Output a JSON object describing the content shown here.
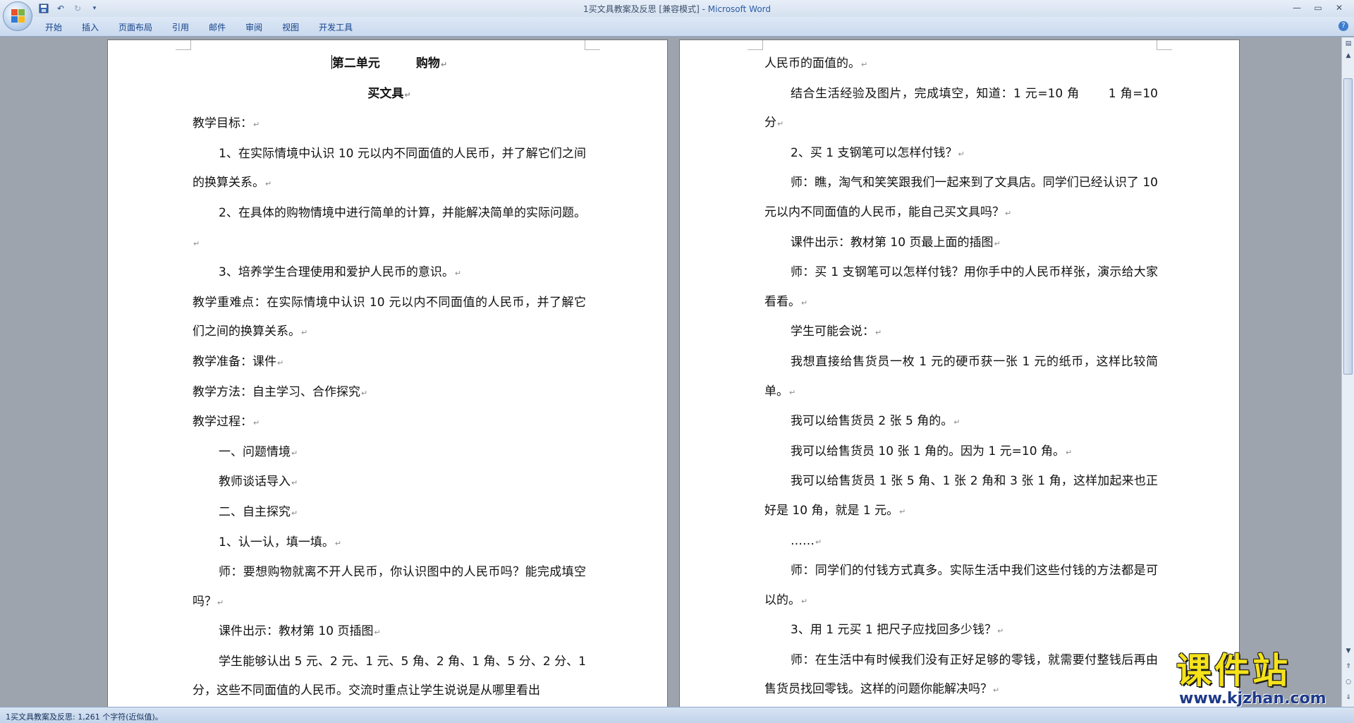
{
  "window": {
    "title_doc": "1买文具教案及反思 [兼容模式] - ",
    "title_app": "Microsoft Word"
  },
  "ribbon": {
    "tabs": [
      "开始",
      "插入",
      "页面布局",
      "引用",
      "邮件",
      "审阅",
      "视图",
      "开发工具"
    ]
  },
  "colors": {
    "titlebar": "#d5e1f0",
    "ribbon_text": "#15428b",
    "workspace": "#9ea4ad",
    "watermark_yellow": "#f5e21a",
    "watermark_blue": "#1d3a8a"
  },
  "icons": {
    "office_button": "office-logo-icon",
    "save": "save-icon",
    "undo": "undo-icon",
    "redo": "redo-icon",
    "customize": "dropdown-arrow-icon",
    "help": "help-icon"
  },
  "document": {
    "left_page": [
      {
        "text": "第二单元　　　购物",
        "style": "center bold",
        "cursor": true
      },
      {
        "text": "买文具",
        "style": "center bold"
      },
      {
        "text": "教学目标：",
        "style": ""
      },
      {
        "text": "1、在实际情境中认识 10 元以内不同面值的人民币，并了解它们之间的换算关系。",
        "style": "indent"
      },
      {
        "text": "2、在具体的购物情境中进行简单的计算，并能解决简单的实际问题。",
        "style": "indent"
      },
      {
        "text": "3、培养学生合理使用和爱护人民币的意识。",
        "style": "indent"
      },
      {
        "text": "教学重难点：在实际情境中认识 10 元以内不同面值的人民币，并了解它们之间的换算关系。",
        "style": ""
      },
      {
        "text": "教学准备：课件",
        "style": ""
      },
      {
        "text": "教学方法：自主学习、合作探究",
        "style": ""
      },
      {
        "text": "教学过程：",
        "style": ""
      },
      {
        "text": "一、问题情境",
        "style": "indent"
      },
      {
        "text": "教师谈话导入",
        "style": "indent"
      },
      {
        "text": "二、自主探究",
        "style": "indent"
      },
      {
        "text": "1、认一认，填一填。",
        "style": "indent"
      },
      {
        "text": "师：要想购物就离不开人民币，你认识图中的人民币吗？能完成填空吗？",
        "style": "indent"
      },
      {
        "text": "课件出示：教材第 10 页插图",
        "style": "indent"
      },
      {
        "text": "学生能够认出 5 元、2 元、1 元、5 角、2 角、1 角、5 分、2 分、1 分，这些不同面值的人民币。交流时重点让学生说说是从哪里看出",
        "style": "indent",
        "no_mark": true
      }
    ],
    "right_page": [
      {
        "text": "人民币的面值的。",
        "style": ""
      },
      {
        "text": "结合生活经验及图片，完成填空，知道：1 元=10 角　　 1 角=10 分",
        "style": "indent"
      },
      {
        "text": "2、买 1 支钢笔可以怎样付钱？",
        "style": "indent"
      },
      {
        "text": "师：瞧，淘气和笑笑跟我们一起来到了文具店。同学们已经认识了 10 元以内不同面值的人民币，能自己买文具吗？",
        "style": "indent"
      },
      {
        "text": "课件出示：教材第 10 页最上面的插图",
        "style": "indent"
      },
      {
        "text": "师：买 1 支钢笔可以怎样付钱？用你手中的人民币样张，演示给大家看看。",
        "style": "indent"
      },
      {
        "text": "学生可能会说：",
        "style": "indent"
      },
      {
        "text": "我想直接给售货员一枚 1 元的硬币获一张 1 元的纸币，这样比较简单。",
        "style": "indent"
      },
      {
        "text": "我可以给售货员 2 张 5 角的。",
        "style": "indent"
      },
      {
        "text": "我可以给售货员 10 张 1 角的。因为 1 元=10 角。",
        "style": "indent"
      },
      {
        "text": "我可以给售货员 1 张 5 角、1 张 2 角和 3 张 1 角，这样加起来也正好是 10 角，就是 1 元。",
        "style": "indent"
      },
      {
        "text": "……",
        "style": "indent"
      },
      {
        "text": "师：同学们的付钱方式真多。实际生活中我们这些付钱的方法都是可以的。",
        "style": "indent"
      },
      {
        "text": "3、用 1 元买 1 把尺子应找回多少钱？",
        "style": "indent"
      },
      {
        "text": "师：在生活中有时候我们没有正好足够的零钱，就需要付整钱后再由售货员找回零钱。这样的问题你能解决吗？",
        "style": "indent"
      }
    ],
    "paragraph_mark": "↵"
  },
  "status_bar": {
    "text": "1买文具教案及反思: 1,261 个字符(近似值)。"
  },
  "watermark": {
    "main": "课件站",
    "url": "www.kjzhan.com"
  }
}
